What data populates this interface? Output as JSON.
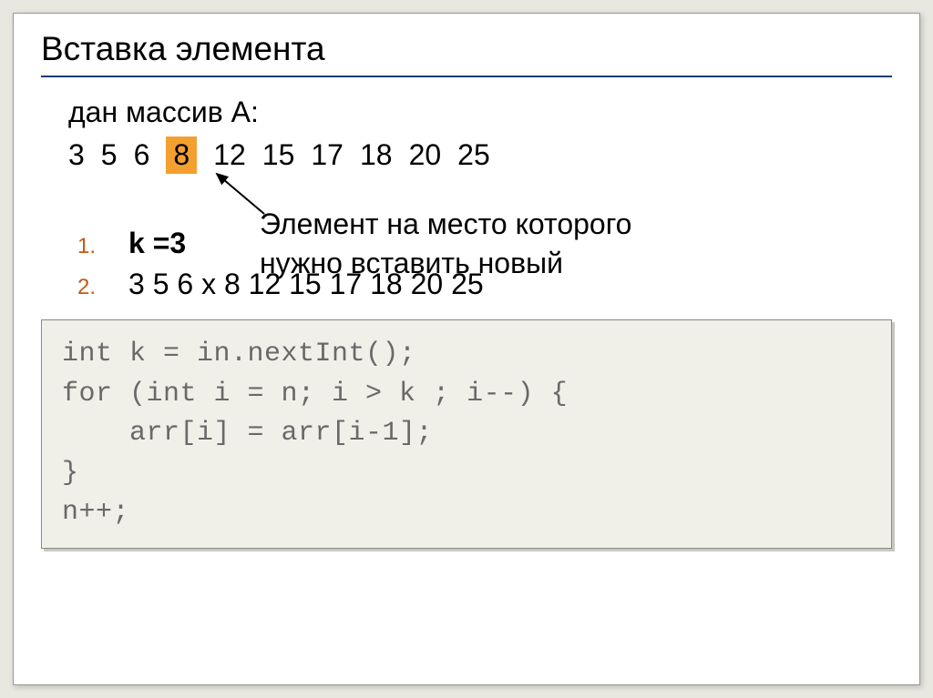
{
  "title": "Вставка элемента",
  "intro": "дан массив A:",
  "array": {
    "values": [
      "3",
      "5",
      "6",
      "8",
      "12",
      "15",
      "17",
      "18",
      "20",
      "25"
    ],
    "highlightedIndex": 3
  },
  "annotation": {
    "line1": "Элемент на место которого",
    "line2": "нужно вставить новый"
  },
  "list": {
    "item1_num": "1.",
    "item1_text": "k =3",
    "item2_num": "2.",
    "item2_text": "3  5  6  х 8 12  15  17  18  20  25"
  },
  "code": "int k = in.nextInt();\nfor (int i = n; i > k ; i--) {\n    arr[i] = arr[i-1];\n}\nn++;"
}
